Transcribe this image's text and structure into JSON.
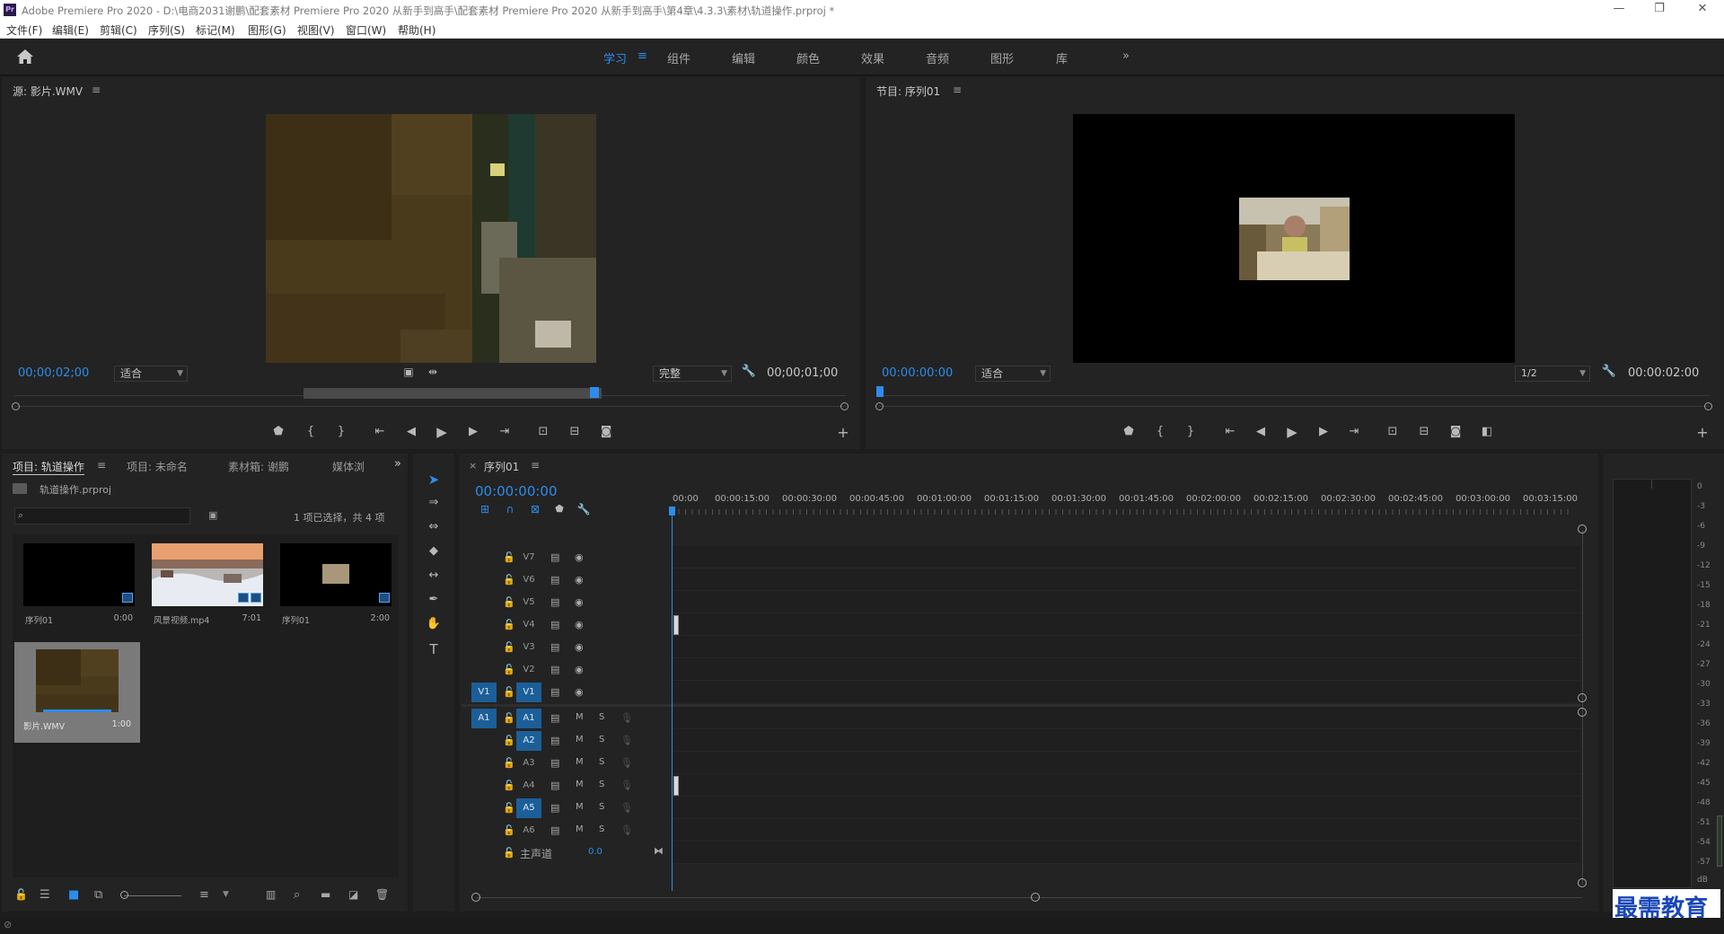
{
  "window": {
    "title": "Adobe Premiere Pro 2020 - D:\\电商2031谢鹏\\配套素材 Premiere Pro 2020 从新手到高手\\配套素材 Premiere Pro 2020 从新手到高手\\第4章\\4.3.3\\素材\\轨道操作.prproj *",
    "app_icon": "Pr",
    "minimize": "—",
    "restore": "❐",
    "close": "✕"
  },
  "menu": [
    "文件(F)",
    "编辑(E)",
    "剪辑(C)",
    "序列(S)",
    "标记(M)",
    "图形(G)",
    "视图(V)",
    "窗口(W)",
    "帮助(H)"
  ],
  "workspaces": {
    "tabs": [
      "学习",
      "组件",
      "编辑",
      "颜色",
      "效果",
      "音频",
      "图形",
      "库"
    ],
    "active": "学习",
    "more": "»",
    "menu_glyph": "≡"
  },
  "source_monitor": {
    "title": "源: 影片.WMV",
    "timecode_current": "00;00;02;00",
    "fit": "适合",
    "quality": "完整",
    "timecode_duration": "00;00;01;00"
  },
  "program_monitor": {
    "title": "节目: 序列01",
    "timecode_current": "00:00:00:00",
    "fit": "适合",
    "resolution": "1/2",
    "timecode_duration": "00:00:02:00"
  },
  "project_panel": {
    "tabs": [
      "项目: 轨道操作",
      "项目: 未命名",
      "素材箱: 谢鹏",
      "媒体浏"
    ],
    "project_file": "轨道操作.prproj",
    "selection_info": "1 项已选择，共 4 项",
    "items": [
      {
        "name": "序列01",
        "duration": "0:00"
      },
      {
        "name": "风景视频.mp4",
        "duration": "7:01"
      },
      {
        "name": "序列01",
        "duration": "2:00"
      },
      {
        "name": "影片.WMV",
        "duration": "1:00"
      }
    ]
  },
  "timeline": {
    "tab": "序列01",
    "close_glyph": "×",
    "timecode": "00:00:00:00",
    "ruler": [
      "00:00",
      "00:00:15:00",
      "00:00:30:00",
      "00:00:45:00",
      "00:01:00:00",
      "00:01:15:00",
      "00:01:30:00",
      "00:01:45:00",
      "00:02:00:00",
      "00:02:15:00",
      "00:02:30:00",
      "00:02:45:00",
      "00:03:00:00",
      "00:03:15:00"
    ],
    "video_tracks": [
      "V7",
      "V6",
      "V5",
      "V4",
      "V3",
      "V2",
      "V1"
    ],
    "audio_tracks": [
      "A1",
      "A2",
      "A3",
      "A4",
      "A5",
      "A6"
    ],
    "source_patch_video": "V1",
    "source_patch_audio": "A1",
    "mute": "M",
    "solo": "S",
    "master_label": "主声道",
    "master_value": "0.0"
  },
  "audio_meter": {
    "labels": [
      "0",
      "-3",
      "-6",
      "-9",
      "-12",
      "-15",
      "-18",
      "-21",
      "-24",
      "-27",
      "-30",
      "-33",
      "-36",
      "-39",
      "-42",
      "-45",
      "-48",
      "-51",
      "-54",
      "-57",
      "dB"
    ]
  },
  "watermark": "最需教育",
  "colors": {
    "accent": "#2d8ceb",
    "panel_bg": "#232323",
    "track_selected": "#1c5f98"
  }
}
